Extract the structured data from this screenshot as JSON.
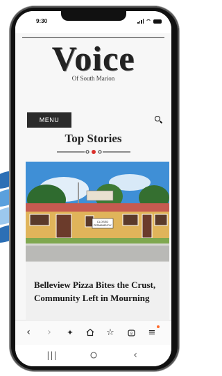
{
  "status_bar": {
    "time": "9:30",
    "icons": [
      "signal-icon",
      "wifi-icon",
      "battery-icon"
    ]
  },
  "masthead": {
    "logo": "Voice",
    "tagline": "Of South Marion"
  },
  "nav": {
    "menu_label": "MENU",
    "search_icon": "search-icon"
  },
  "section": {
    "title": "Top Stories"
  },
  "story": {
    "headline": "Belleview Pizza Bites the Crust, Community Left in Mourning",
    "sign_text_line1": "CLOSED",
    "sign_text_line2": "PERMANENTLY"
  },
  "browser_toolbar": {
    "items": [
      "back-icon",
      "forward-icon",
      "sparkle-icon",
      "home-icon",
      "bookmark-star-icon",
      "tabs-icon",
      "menu-icon"
    ],
    "tab_count": "8",
    "menu_badge_color": "#ff6a2a"
  },
  "system_nav": {
    "items": [
      "recents-icon",
      "home-circle-icon",
      "back-chevron-icon"
    ]
  },
  "colors": {
    "menu_button_bg": "#2b2b2b",
    "ornament_dot": "#d9302c",
    "roof": "#c65a50",
    "wall": "#e0b45a",
    "sky": "#3f8fd6"
  }
}
